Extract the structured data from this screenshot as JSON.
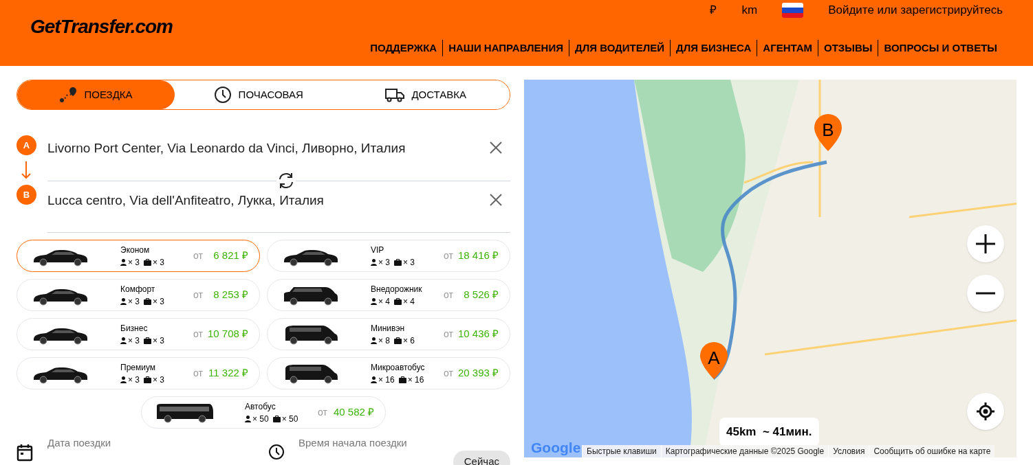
{
  "header": {
    "logo": "GetTransfer.com",
    "currency": "₽",
    "units": "km",
    "login": "Войдите или зарегистрируйтесь",
    "nav": [
      "ПОДДЕРЖКА",
      "НАШИ НАПРАВЛЕНИЯ",
      "ДЛЯ ВОДИТЕЛЕЙ",
      "ДЛЯ БИЗНЕСА",
      "АГЕНТАМ",
      "ОТЗЫВЫ",
      "ВОПРОСЫ И ОТВЕТЫ"
    ]
  },
  "tabs": [
    {
      "label": "ПОЕЗДКА",
      "kind": "route",
      "selected": true
    },
    {
      "label": "ПОЧАСОВАЯ",
      "kind": "hourly",
      "selected": false
    },
    {
      "label": "ДОСТАВКА",
      "kind": "delivery",
      "selected": false
    }
  ],
  "route": {
    "from": {
      "marker": "A",
      "value": "Livorno Port Center, Via Leonardo da Vinci, Ливорно, Италия"
    },
    "to": {
      "marker": "B",
      "value": "Lucca centro, Via dell'Anfiteatro, Лукка, Италия"
    }
  },
  "vehicles": [
    {
      "name": "Эконом",
      "kind": "sedan",
      "passengers": "× 3",
      "bags": "× 3",
      "from": "от",
      "price": "6 821 ₽",
      "selected": true
    },
    {
      "name": "VIP",
      "kind": "sedan",
      "passengers": "× 3",
      "bags": "× 3",
      "from": "от",
      "price": "18 416 ₽",
      "selected": false
    },
    {
      "name": "Комфорт",
      "kind": "sedan",
      "passengers": "× 3",
      "bags": "× 3",
      "from": "от",
      "price": "8 253 ₽",
      "selected": false
    },
    {
      "name": "Внедорожник",
      "kind": "suv",
      "passengers": "× 4",
      "bags": "× 4",
      "from": "от",
      "price": "8 526 ₽",
      "selected": false
    },
    {
      "name": "Бизнес",
      "kind": "sedan",
      "passengers": "× 3",
      "bags": "× 3",
      "from": "от",
      "price": "10 708 ₽",
      "selected": false
    },
    {
      "name": "Минивэн",
      "kind": "van",
      "passengers": "× 8",
      "bags": "× 6",
      "from": "от",
      "price": "10 436 ₽",
      "selected": false
    },
    {
      "name": "Премиум",
      "kind": "sedan",
      "passengers": "× 3",
      "bags": "× 3",
      "from": "от",
      "price": "11 322 ₽",
      "selected": false
    },
    {
      "name": "Микроавтобус",
      "kind": "van",
      "passengers": "× 16",
      "bags": "× 16",
      "from": "от",
      "price": "20 393 ₽",
      "selected": false
    },
    {
      "name": "Автобус",
      "kind": "bus",
      "passengers": "× 50",
      "bags": "× 50",
      "from": "от",
      "price": "40 582 ₽",
      "selected": false
    }
  ],
  "date": {
    "placeholder": "Дата поездки"
  },
  "time": {
    "placeholder": "Время начала поездки",
    "now_button": "Сейчас"
  },
  "map": {
    "markers": [
      "A",
      "B"
    ],
    "trip": "45km  ~ 41мин.",
    "logo": "Google",
    "footer": [
      "Быстрые клавиши",
      "Картографические данные ©2025 Google",
      "Условия",
      "Сообщить об ошибке на карте"
    ]
  }
}
